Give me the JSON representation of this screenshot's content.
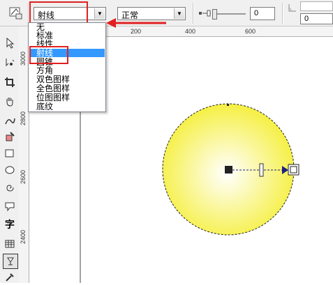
{
  "propbar": {
    "fill_type_value": "射线",
    "merge_mode_value": "正常",
    "opacity_value": "0",
    "angle_value": "0"
  },
  "dropdown": {
    "items": [
      "无",
      "标准",
      "线性",
      "射线",
      "圆锥",
      "方角",
      "双色图样",
      "全色图样",
      "位图图样",
      "底纹"
    ],
    "selected_index": 3
  },
  "ruler": {
    "top_ticks": [
      "200",
      "400",
      "600"
    ],
    "left_ticks": [
      "2800",
      "2600",
      "2400"
    ],
    "corner_left": "3000"
  },
  "toolbox": {
    "text_tool_label": "字"
  },
  "colors": {
    "annotation_red": "#e02020",
    "highlight_blue": "#3399ff",
    "fill_center": "#ffffff",
    "fill_edge": "#f5ef3c"
  }
}
